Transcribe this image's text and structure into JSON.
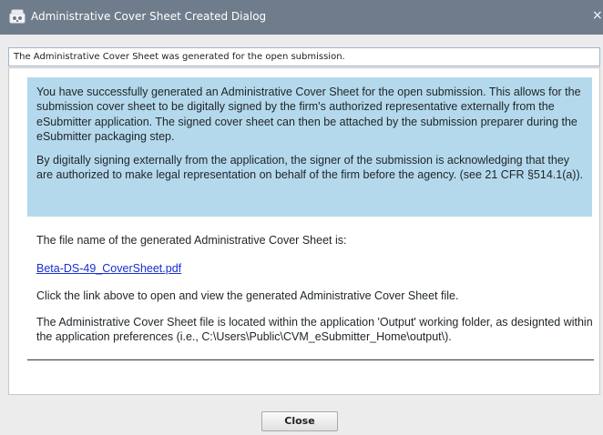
{
  "window": {
    "title": "Administrative Cover Sheet Created Dialog",
    "app_icon": "app-icon",
    "close_glyph": "×",
    "title_bar_color": "#6f7c8c"
  },
  "header": {
    "message": "The Administrative Cover Sheet was generated for the open submission."
  },
  "info_box": {
    "background": "#b5d9ec",
    "paragraph1": "You have successfully generated an Administrative Cover Sheet for the open submission. This allows for the submission cover sheet to be digitally signed by the firm's authorized representative externally from the eSubmitter application. The signed cover sheet can then be attached by the submission preparer during the eSubmitter packaging step.",
    "paragraph2": "By digitally signing externally from the application, the signer of the submission is acknowledging that they are authorized to make legal representation on behalf of the firm before the agency. (see 21 CFR §514.1(a))."
  },
  "body": {
    "file_name_label": "The file name of the generated Administrative Cover Sheet is:",
    "file_link": "Beta-DS-49_CoverSheet.pdf",
    "link_instruction": "Click the link above to open and view the generated Administrative Cover Sheet file.",
    "location_note": "The Administrative Cover Sheet file is located within the application 'Output' working folder, as designted within the application preferences (i.e., C:\\Users\\Public\\CVM_eSubmitter_Home\\output\\)."
  },
  "footer": {
    "close_label": "Close"
  }
}
